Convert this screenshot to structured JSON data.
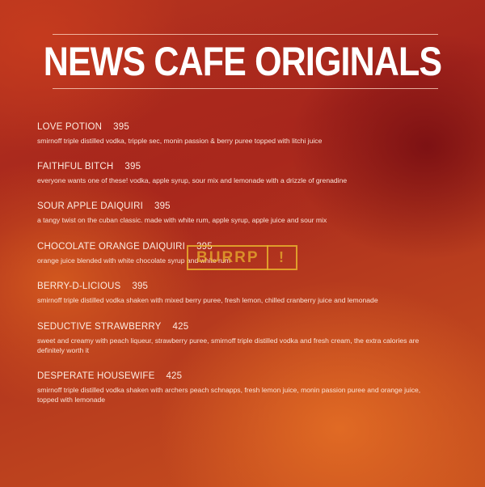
{
  "title": "NEWS CAFE ORIGINALS",
  "items": [
    {
      "name": "LOVE POTION",
      "price": "395",
      "description": "smirnoff triple distilled vodka, tripple sec, monin passion & berry puree topped with litchi juice"
    },
    {
      "name": "FAITHFUL BITCH",
      "price": "395",
      "description": "everyone wants one of these! vodka, apple syrup,  sour mix and lemonade with a drizzle of grenadine"
    },
    {
      "name": "SOUR APPLE DAIQUIRI",
      "price": "395",
      "description": "a tangy twist on the cuban classic. made with  white rum, apple syrup, apple juice and sour mix"
    },
    {
      "name": "CHOCOLATE ORANGE DAIQUIRI",
      "price": "395",
      "description": "orange juice blended with white chocolate syrup and white rum"
    },
    {
      "name": "BERRY-D-LICIOUS",
      "price": "395",
      "description": "smirnoff triple distilled vodka shaken with mixed berry puree, fresh lemon, chilled cranberry juice and lemonade"
    },
    {
      "name": "SEDUCTIVE STRAWBERRY",
      "price": "425",
      "description": "sweet and creamy with peach liqueur, strawberry puree, smirnoff triple distilled vodka and fresh cream, the extra calories are definitely worth it"
    },
    {
      "name": "DESPERATE HOUSEWIFE",
      "price": "425",
      "description": "smirnoff triple distilled vodka shaken with archers peach schnapps, fresh lemon juice, monin passion puree and orange juice, topped with lemonade"
    }
  ],
  "watermark": {
    "text": "BURRP",
    "mark": "!"
  }
}
